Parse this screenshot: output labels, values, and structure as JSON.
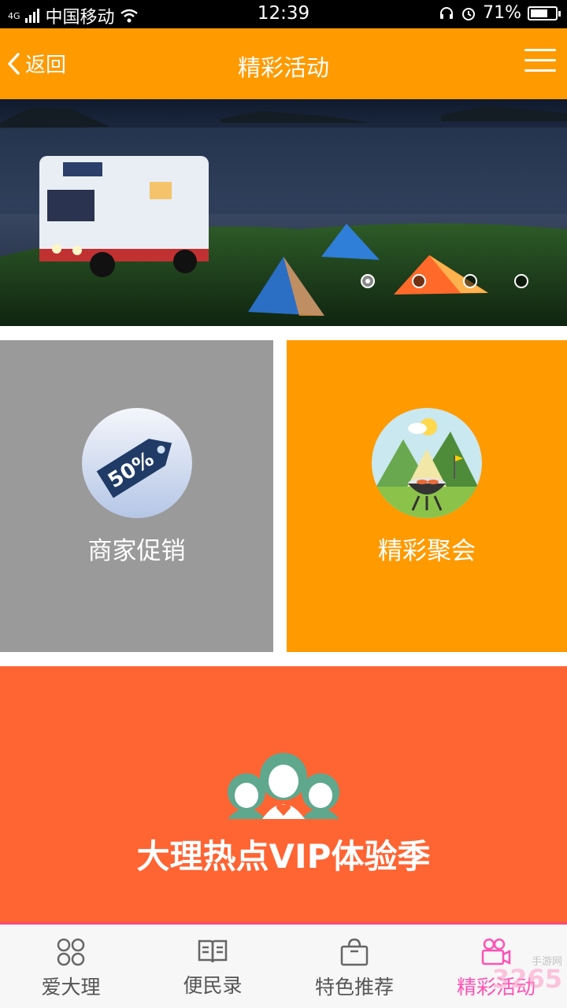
{
  "status_bar": {
    "carrier": "中国移动",
    "network": "4G",
    "time": "12:39",
    "battery": "71%",
    "battery_level": 0.71
  },
  "header": {
    "back_label": "返回",
    "title": "精彩活动"
  },
  "banner": {
    "slide_count": 4,
    "active_index": 0
  },
  "tiles": {
    "promo": {
      "label": "商家促销",
      "badge_text": "50%",
      "color": "#9a9a9a"
    },
    "party": {
      "label": "精彩聚会",
      "color": "#ff9a00"
    },
    "vip": {
      "label": "大理热点VIP体验季",
      "color": "#ff6433"
    }
  },
  "bottom_nav": {
    "items": [
      {
        "label": "爱大理",
        "icon": "four-petal-icon"
      },
      {
        "label": "便民录",
        "icon": "book-icon"
      },
      {
        "label": "特色推荐",
        "icon": "shopping-bag-icon"
      },
      {
        "label": "精彩活动",
        "icon": "video-camera-icon",
        "active": true
      }
    ]
  },
  "watermark": {
    "text": "3265",
    "subtext": "手游网"
  },
  "colors": {
    "accent": "#ff9a00",
    "active_nav": "#ff52b4"
  }
}
